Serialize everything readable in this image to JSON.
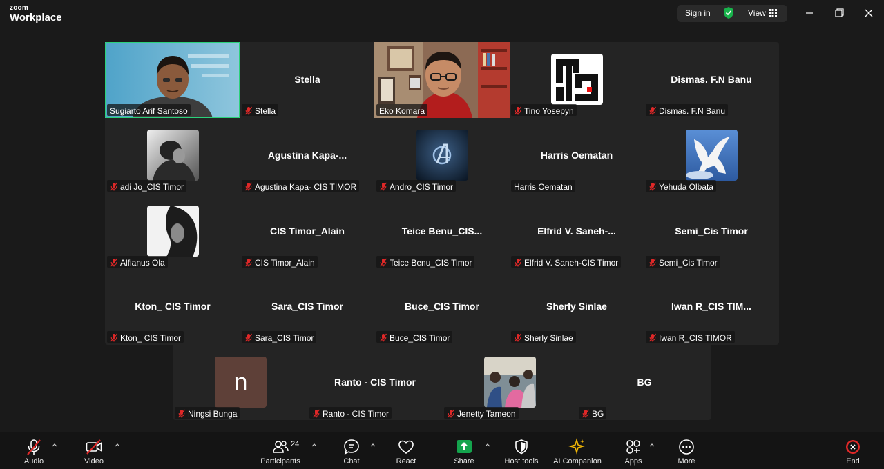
{
  "app": {
    "logo_top": "zoom",
    "logo_bottom": "Workplace"
  },
  "titlebar": {
    "sign_in": "Sign in",
    "view": "View"
  },
  "participants": [
    {
      "id": "sugiarto",
      "display": "video",
      "label": "Sugiarto Arif Santoso",
      "muted": false,
      "active": true
    },
    {
      "id": "stella",
      "display": "name",
      "big_name": "Stella",
      "label": "Stella",
      "muted": true
    },
    {
      "id": "eko",
      "display": "video",
      "label": "Eko Komara",
      "muted": false
    },
    {
      "id": "tino",
      "display": "avatar",
      "avatar": "qr-logo",
      "label": "Tino Yosepyn",
      "muted": true
    },
    {
      "id": "dismas",
      "display": "name",
      "big_name": "Dismas. F.N Banu",
      "label": "Dismas. F.N Banu",
      "muted": true
    },
    {
      "id": "adi",
      "display": "avatar",
      "avatar": "bw-photo",
      "label": "adi Jo_CIS Timor",
      "muted": true
    },
    {
      "id": "agustina",
      "display": "name",
      "big_name": "Agustina  Kapa-...",
      "label": "Agustina Kapa- CIS TIMOR",
      "muted": true
    },
    {
      "id": "andro",
      "display": "avatar",
      "avatar": "avengers-logo",
      "label": "Andro_CIS Timor",
      "muted": true
    },
    {
      "id": "harris",
      "display": "name",
      "big_name": "Harris Oematan",
      "label": "Harris Oematan",
      "muted": false
    },
    {
      "id": "yehuda",
      "display": "avatar",
      "avatar": "pegasus",
      "label": "Yehuda Olbata",
      "muted": true
    },
    {
      "id": "alfianus",
      "display": "avatar",
      "avatar": "bw-portrait",
      "label": "Alfianus Ola",
      "muted": true
    },
    {
      "id": "alain",
      "display": "name",
      "big_name": "CIS Timor_Alain",
      "label": "CIS Timor_Alain",
      "muted": true
    },
    {
      "id": "teice",
      "display": "name",
      "big_name": "Teice  Benu_CIS...",
      "label": "Teice Benu_CIS Timor",
      "muted": true
    },
    {
      "id": "elfrid",
      "display": "name",
      "big_name": "Elfrid  V.  Saneh-...",
      "label": "Elfrid V. Saneh-CIS Timor",
      "muted": true
    },
    {
      "id": "semi",
      "display": "name",
      "big_name": "Semi_Cis Timor",
      "label": "Semi_Cis Timor",
      "muted": true
    },
    {
      "id": "kton",
      "display": "name",
      "big_name": "Kton_ CIS Timor",
      "label": "Kton_ CIS Timor",
      "muted": true
    },
    {
      "id": "sara",
      "display": "name",
      "big_name": "Sara_CIS Timor",
      "label": "Sara_CIS Timor",
      "muted": true
    },
    {
      "id": "buce",
      "display": "name",
      "big_name": "Buce_CIS Timor",
      "label": "Buce_CIS Timor",
      "muted": true
    },
    {
      "id": "sherly",
      "display": "name",
      "big_name": "Sherly Sinlae",
      "label": "Sherly Sinlae",
      "muted": true
    },
    {
      "id": "iwan",
      "display": "name",
      "big_name": "Iwan  R_CIS  TIM...",
      "label": "Iwan R_CIS TIMOR",
      "muted": true
    },
    {
      "id": "ningsi",
      "display": "avatar",
      "avatar": "letter",
      "letter": "n",
      "label": "Ningsi Bunga",
      "muted": true
    },
    {
      "id": "ranto",
      "display": "name",
      "big_name": "Ranto - CIS Timor",
      "label": "Ranto - CIS Timor",
      "muted": true
    },
    {
      "id": "jenetty",
      "display": "avatar",
      "avatar": "group-photo",
      "label": "Jenetty Tameon",
      "muted": true
    },
    {
      "id": "bg",
      "display": "name",
      "big_name": "BG",
      "label": "BG",
      "muted": true
    }
  ],
  "toolbar": {
    "audio": "Audio",
    "video": "Video",
    "participants": "Participants",
    "participants_count": "24",
    "chat": "Chat",
    "react": "React",
    "share": "Share",
    "host_tools": "Host tools",
    "ai_companion": "AI Companion",
    "apps": "Apps",
    "more": "More",
    "end": "End"
  },
  "colors": {
    "active_speaker": "#2bd27b",
    "muted": "#e02828",
    "share": "#14a44d",
    "end": "#e02828",
    "ningsi_avatar": "#5e4038"
  }
}
